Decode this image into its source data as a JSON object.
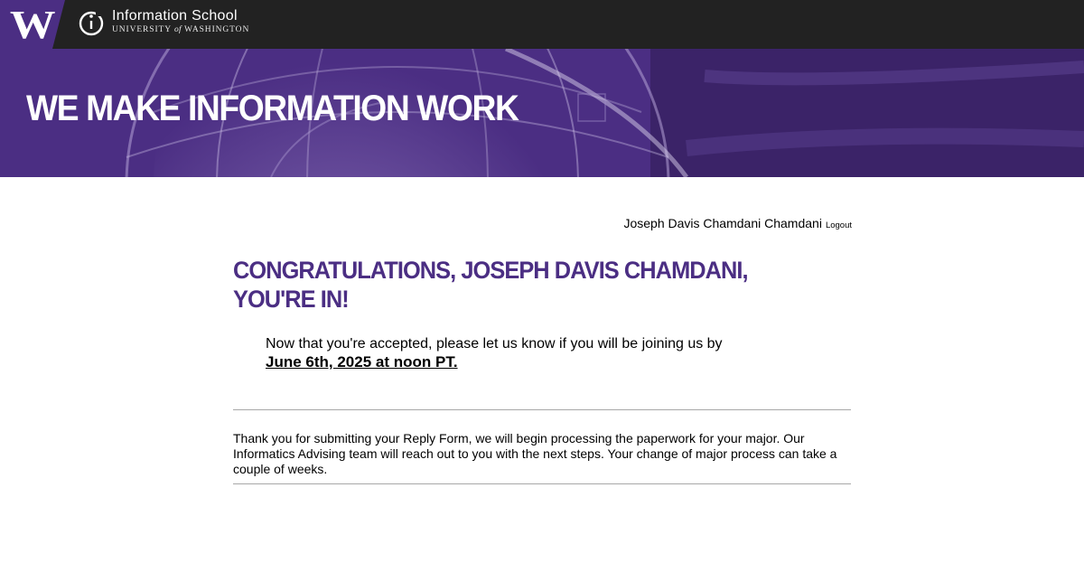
{
  "header": {
    "school_name": "Information School",
    "university_prefix": "UNIVERSITY",
    "university_of": "of",
    "university_suffix": "WASHINGTON",
    "brand_color": "#4b2e83",
    "gold_color": "#b7a57a",
    "bar_color": "#222222"
  },
  "hero": {
    "title": "WE MAKE INFORMATION WORK"
  },
  "user": {
    "name": "Joseph Davis Chamdani Chamdani",
    "logout_label": "Logout"
  },
  "main": {
    "congrats_heading": "CONGRATULATIONS, JOSEPH DAVIS CHAMDANI, YOU'RE IN!",
    "accept_message": "Now that you're accepted, please let us know if you will be joining us by",
    "deadline": "June 6th, 2025 at noon PT.",
    "thanks_message": "Thank you for submitting your Reply Form, we will begin processing the paperwork for your major. Our Informatics Advising team will reach out to you with the next steps. Your change of major process can take a couple of weeks."
  }
}
